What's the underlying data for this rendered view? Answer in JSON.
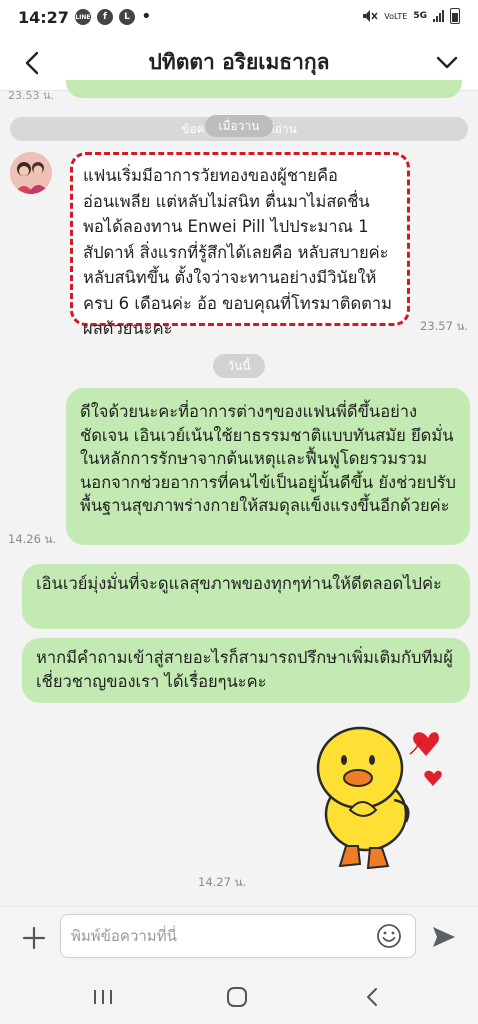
{
  "status_bar": {
    "time": "14:27",
    "apps": [
      "LINE",
      "f",
      "L"
    ],
    "network": "VoLTE",
    "wifi": "5G"
  },
  "header": {
    "title": "ปทิตตา อริยเมธากุล"
  },
  "chat": {
    "prev_time": "23.53 น.",
    "unread_bar": "ข้อความที่ยังไม่ได้อ่าน",
    "read_tag": "เมื่อวาน",
    "incoming": {
      "text": "แฟนเริ่มมีอาการวัยทองของผู้ชายคือ อ่อนเพลีย แต่หลับไม่สนิท ตื่นมาไม่สดชื่น พอได้ลองทาน Enwei Pill ไปประมาณ 1 สัปดาห์ สิ่งแรกที่รู้สึกได้เลยคือ หลับสบายค่ะ หลับสนิทขึ้น ตั้งใจว่าจะทานอย่างมีวินัยให้ครบ 6 เดือนค่ะ อ้อ ขอบคุณที่โทรมาติดตามผลด้วยนะคะ",
      "time": "23.57 น."
    },
    "date_pill": "วันนี้",
    "outgoing": [
      {
        "text": "ดีใจด้วยนะคะที่อาการต่างๆของแฟนพี่ดีขึ้นอย่างชัดเจน เอินเวย์เน้นใช้ยาธรรมชาติแบบทันสมัย ยึดมั่นในหลักการรักษาจากต้นเหตุและฟื้นฟูโดยรวมรวม นอกจากช่วยอาการที่คนไข้เป็นอยู่นั้นดีขึ้น ยังช่วยปรับพื้นฐานสุขภาพร่างกายให้สมดุลแข็งแรงขึ้นอีกด้วยค่ะ",
        "time": "14.26 น."
      },
      {
        "text": "เอินเวย์มุ่งมั่นที่จะดูแลสุขภาพของทุกๆท่านให้ดีตลอดไปค่ะ"
      },
      {
        "text": "หากมีคำถามเข้าสู่สายอะไรก็สามารถปรึกษาเพิ่มเติมกับทีมผู้เชี่ยวชาญของเรา ได้เรื่อยๆนะคะ"
      }
    ],
    "sticker_time": "14.27 น."
  },
  "input": {
    "placeholder": "พิมพ์ข้อความที่นี่"
  },
  "colors": {
    "outgoing_bubble": "#c3eab2",
    "highlight_border": "#d61826"
  }
}
